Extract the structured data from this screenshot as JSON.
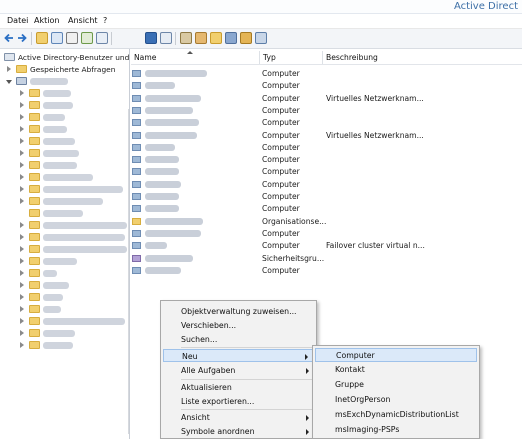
{
  "window": {
    "title": "Active Direct"
  },
  "menu": [
    "Datei",
    "Aktion",
    "Ansicht",
    "?"
  ],
  "tree": {
    "root_label": "Active Directory-Benutzer und -",
    "saved_queries": "Gespeicherte Abfragen"
  },
  "columns": {
    "name": "Name",
    "type": "Typ",
    "description": "Beschreibung"
  },
  "rows": [
    {
      "icon": "computer-icon",
      "type": "Computer",
      "description": ""
    },
    {
      "icon": "computer-icon",
      "type": "Computer",
      "description": ""
    },
    {
      "icon": "computer-icon",
      "type": "Computer",
      "description": "Virtuelles Netzwerknam..."
    },
    {
      "icon": "computer-icon",
      "type": "Computer",
      "description": ""
    },
    {
      "icon": "computer-icon",
      "type": "Computer",
      "description": ""
    },
    {
      "icon": "computer-icon",
      "type": "Computer",
      "description": "Virtuelles Netzwerknam..."
    },
    {
      "icon": "computer-icon",
      "type": "Computer",
      "description": ""
    },
    {
      "icon": "computer-icon",
      "type": "Computer",
      "description": ""
    },
    {
      "icon": "computer-icon",
      "type": "Computer",
      "description": ""
    },
    {
      "icon": "computer-icon",
      "type": "Computer",
      "description": ""
    },
    {
      "icon": "computer-icon",
      "type": "Computer",
      "description": ""
    },
    {
      "icon": "computer-icon",
      "type": "Computer",
      "description": ""
    },
    {
      "icon": "folder-icon",
      "type": "Organisationse...",
      "description": ""
    },
    {
      "icon": "computer-icon",
      "type": "Computer",
      "description": ""
    },
    {
      "icon": "computer-icon",
      "type": "Computer",
      "description": "Failover cluster virtual n..."
    },
    {
      "icon": "group-icon",
      "type": "Sicherheitsgru...",
      "description": ""
    },
    {
      "icon": "computer-icon",
      "type": "Computer",
      "description": ""
    }
  ],
  "context_menu": {
    "delegate": "Objektverwaltung zuweisen...",
    "move": "Verschieben...",
    "find": "Suchen...",
    "new": "Neu",
    "all_tasks": "Alle Aufgaben",
    "refresh": "Aktualisieren",
    "export": "Liste exportieren...",
    "view": "Ansicht",
    "arrange": "Symbole anordnen"
  },
  "submenu": {
    "computer": "Computer",
    "contact": "Kontakt",
    "group": "Gruppe",
    "inetorgperson": "InetOrgPerson",
    "msexch": "msExchDynamicDistributionList",
    "msimaging": "msImaging-PSPs"
  }
}
